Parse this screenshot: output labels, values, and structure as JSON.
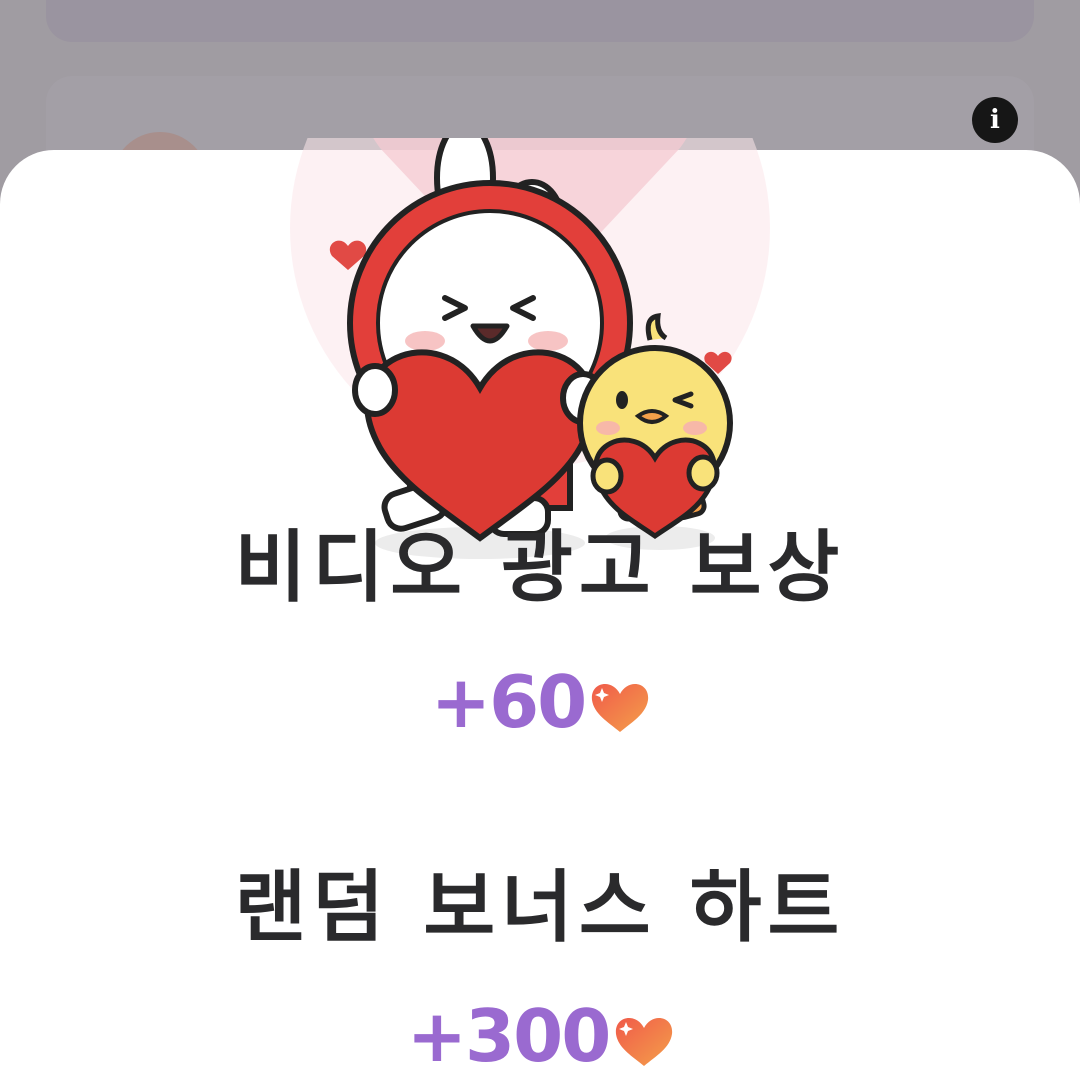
{
  "background": {
    "info_icon": "i"
  },
  "sheet": {
    "illustration": "rabbit-and-chick-holding-hearts",
    "video_ad_reward": {
      "title": "비디오 광고 보상",
      "amount": "+60",
      "icon": "heart-icon"
    },
    "random_bonus": {
      "title": "랜덤 보너스 하트",
      "amount": "+300",
      "icon": "heart-icon"
    }
  },
  "colors": {
    "amount": "#9a6ad0",
    "heart_top": "#f05a4a",
    "heart_bottom": "#f4a04a",
    "title": "#2a2a2c"
  }
}
